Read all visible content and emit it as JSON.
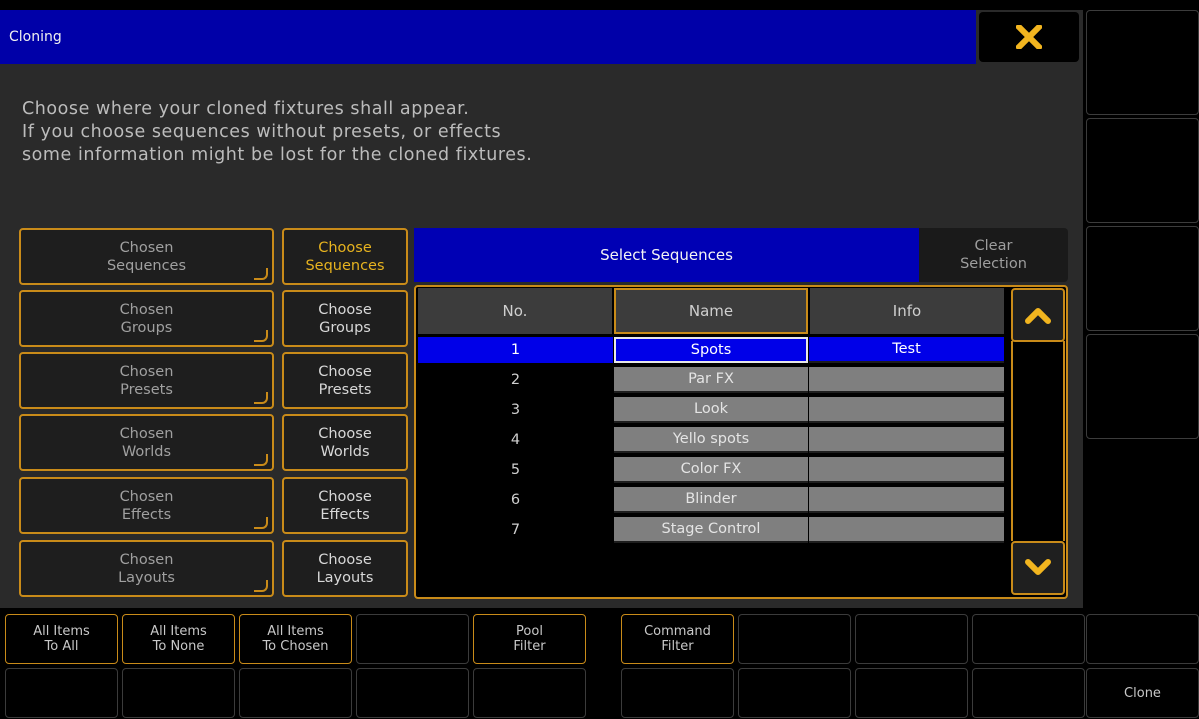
{
  "dialog": {
    "title": "Cloning",
    "instructions": [
      "Choose where your cloned fixtures shall appear.",
      "If you choose sequences without presets, or effects",
      "some information might be lost for the cloned fixtures."
    ]
  },
  "left_panel": {
    "rows": [
      {
        "chosen": [
          "Chosen",
          "Sequences"
        ],
        "choose": [
          "Choose",
          "Sequences"
        ]
      },
      {
        "chosen": [
          "Chosen",
          "Groups"
        ],
        "choose": [
          "Choose",
          "Groups"
        ]
      },
      {
        "chosen": [
          "Chosen",
          "Presets"
        ],
        "choose": [
          "Choose",
          "Presets"
        ]
      },
      {
        "chosen": [
          "Chosen",
          "Worlds"
        ],
        "choose": [
          "Choose",
          "Worlds"
        ]
      },
      {
        "chosen": [
          "Chosen",
          "Effects"
        ],
        "choose": [
          "Choose",
          "Effects"
        ]
      },
      {
        "chosen": [
          "Chosen",
          "Layouts"
        ],
        "choose": [
          "Choose",
          "Layouts"
        ]
      }
    ]
  },
  "select_panel": {
    "title": "Select Sequences",
    "clear_selection": [
      "Clear",
      "Selection"
    ]
  },
  "table": {
    "columns": [
      "No.",
      "Name",
      "Info"
    ],
    "rows": [
      {
        "no": "1",
        "name": "Spots",
        "info": "Test"
      },
      {
        "no": "2",
        "name": "Par FX",
        "info": ""
      },
      {
        "no": "3",
        "name": "Look",
        "info": ""
      },
      {
        "no": "4",
        "name": "Yello spots",
        "info": ""
      },
      {
        "no": "5",
        "name": "Color FX",
        "info": ""
      },
      {
        "no": "6",
        "name": "Blinder",
        "info": ""
      },
      {
        "no": "7",
        "name": "Stage Control",
        "info": ""
      }
    ]
  },
  "bottom_bar": {
    "all_to_all": [
      "All Items",
      "To All"
    ],
    "all_to_none": [
      "All Items",
      "To None"
    ],
    "all_to_chosen": [
      "All Items",
      "To Chosen"
    ],
    "pool_filter": [
      "Pool",
      "Filter"
    ],
    "command_filter": [
      "Command",
      "Filter"
    ],
    "clone": "Clone"
  },
  "colors": {
    "title_bar": "#0000a8",
    "accent_gold": "#c98b19",
    "selection_blue": "#0000e8",
    "close_icon": "#f2b51f"
  },
  "icons": {
    "close": "x-icon",
    "scroll_up": "chevron-up-icon",
    "scroll_down": "chevron-down-icon"
  }
}
